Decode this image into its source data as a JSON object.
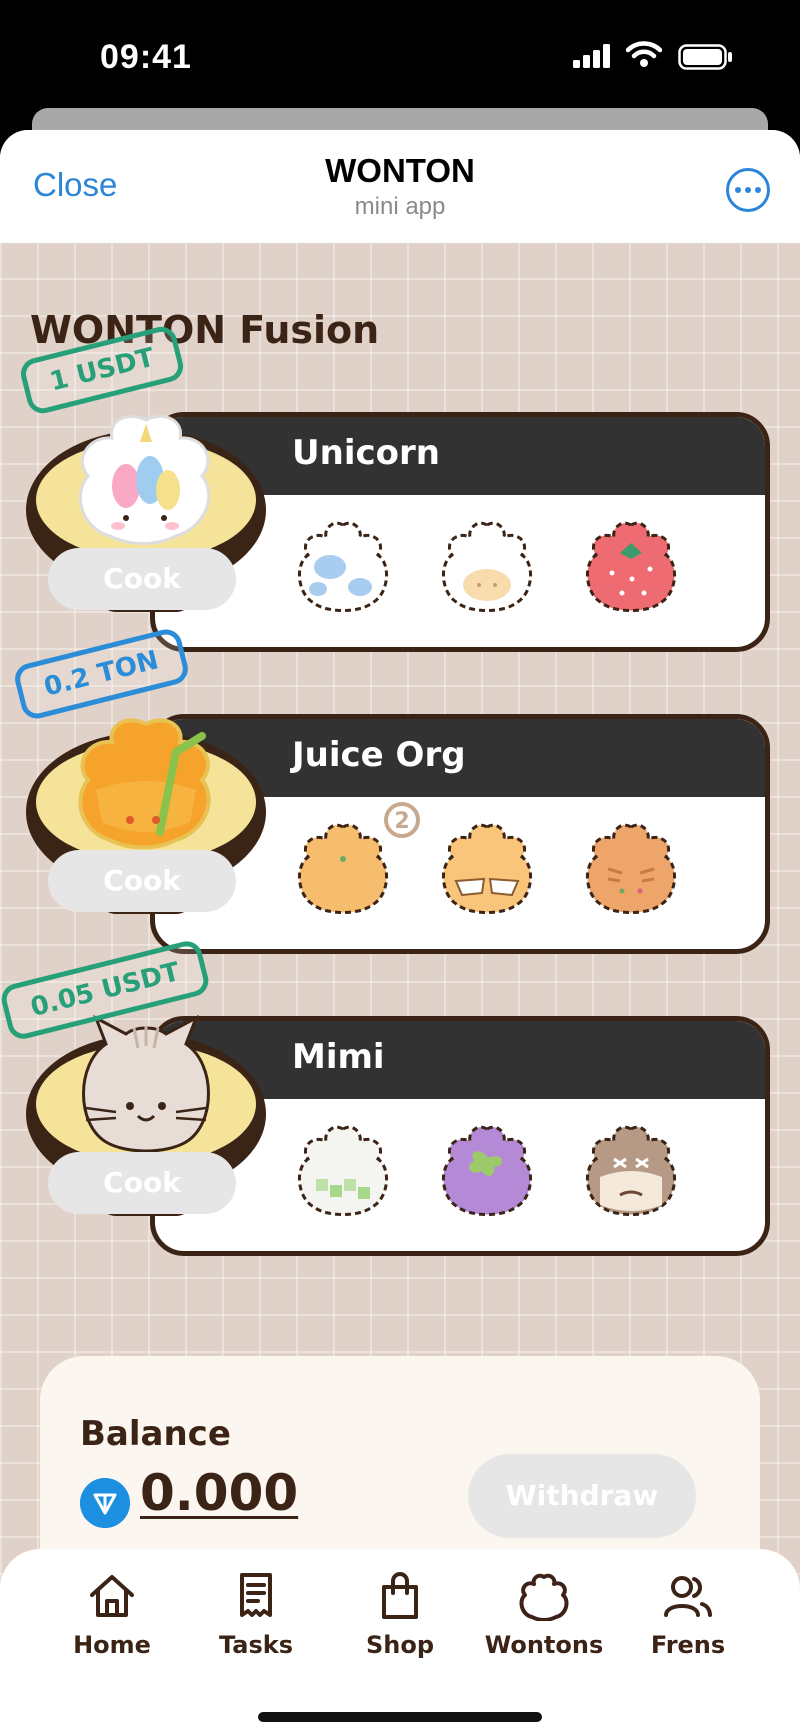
{
  "status_bar": {
    "time": "09:41"
  },
  "header": {
    "close_label": "Close",
    "title": "WONTON",
    "subtitle": "mini app"
  },
  "page": {
    "title": "WONTON Fusion"
  },
  "recipes": [
    {
      "name": "Unicorn",
      "price": "1 USDT",
      "cook_label": "Cook",
      "ingredients": [
        "cow-wonton-icon",
        "bun-wonton-icon",
        "strawberry-wonton-icon"
      ]
    },
    {
      "name": "Juice Org",
      "price": "0.2 TON",
      "cook_label": "Cook",
      "ingredients": [
        "orange-wonton-icon",
        "sunglasses-wonton-icon",
        "tiger-wonton-icon"
      ],
      "badge": "2"
    },
    {
      "name": "Mimi",
      "price": "0.05 USDT",
      "cook_label": "Cook",
      "ingredients": [
        "matcha-wonton-icon",
        "grape-wonton-icon",
        "bearded-wonton-icon"
      ]
    }
  ],
  "balance": {
    "label": "Balance",
    "value": "0.000",
    "withdraw_label": "Withdraw"
  },
  "tabs": [
    {
      "label": "Home",
      "icon": "home-icon"
    },
    {
      "label": "Tasks",
      "icon": "tasks-icon"
    },
    {
      "label": "Shop",
      "icon": "shop-icon"
    },
    {
      "label": "Wontons",
      "icon": "wonton-icon"
    },
    {
      "label": "Frens",
      "icon": "friends-icon"
    }
  ],
  "colors": {
    "accent_blue": "#2b86d9",
    "brown": "#3b2416",
    "green_tag": "#27a07a",
    "blue_tag": "#2b8cd8",
    "background": "#e0d2c8"
  }
}
